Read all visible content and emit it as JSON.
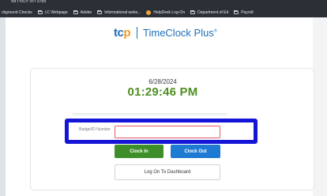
{
  "browser": {
    "top_strip_text": "wd t rou ir vo r a tod",
    "bookmarks": [
      {
        "label": "ckground Checks",
        "icon": "none"
      },
      {
        "label": "LC Webpage",
        "icon": "folder-icon"
      },
      {
        "label": "Adobe",
        "icon": "folder-icon"
      },
      {
        "label": "Informational webs...",
        "icon": "folder-icon"
      },
      {
        "label": "HelpDesk Log-On",
        "icon": "helpdesk-icon"
      },
      {
        "label": "Department of Ed",
        "icon": "folder-icon"
      },
      {
        "label": "Payroll",
        "icon": "folder-icon"
      }
    ]
  },
  "header": {
    "logo_tc": "tc",
    "logo_p": "p",
    "product_name": "TimeClock Plus",
    "trademark": "®"
  },
  "clock": {
    "date": "6/28/2024",
    "time": "01:29:46 PM"
  },
  "form": {
    "badge_label": "Badge/ID Number",
    "badge_value": "",
    "badge_placeholder": ""
  },
  "actions": {
    "clock_in": "Clock In",
    "clock_out": "Clock Out",
    "dashboard": "Log On To Dashboard"
  },
  "colors": {
    "time_green": "#4f8f22",
    "clock_in_bg": "#3e8e2a",
    "clock_out_bg": "#1f7bd2",
    "highlight_blue": "#1515d8",
    "input_error_border": "#e35d5d",
    "brand_blue": "#1d6fb8",
    "brand_orange": "#f39a1e"
  }
}
